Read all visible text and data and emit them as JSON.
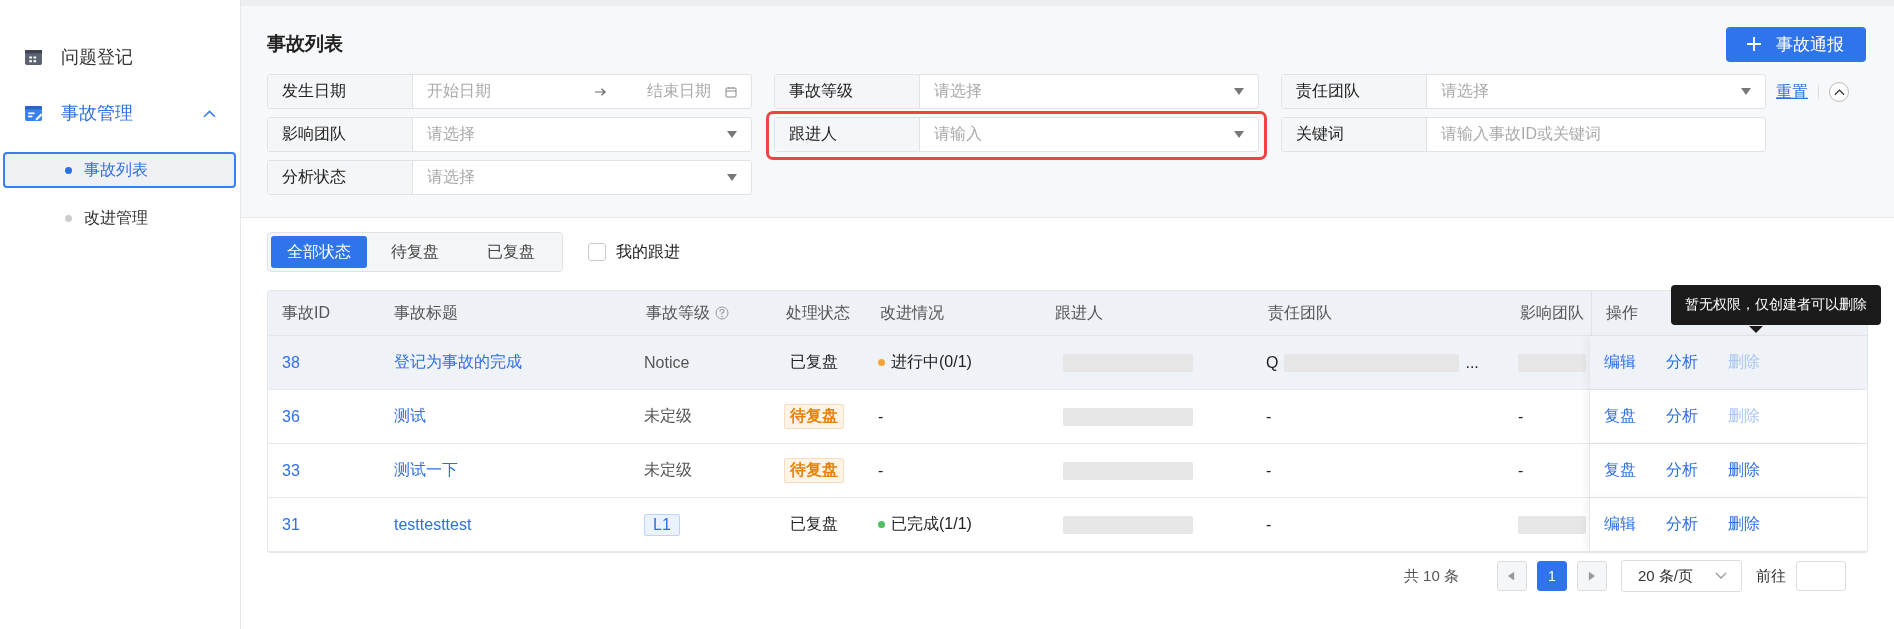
{
  "sidebar": {
    "items": [
      {
        "label": "问题登记",
        "selected": false
      },
      {
        "label": "事故管理",
        "selected": true,
        "expanded": true,
        "children": [
          {
            "label": "事故列表",
            "selected": true
          },
          {
            "label": "改进管理",
            "selected": false
          }
        ]
      }
    ]
  },
  "page_title": "事故列表",
  "report_button": {
    "label": "事故通报"
  },
  "filters": [
    {
      "label": "发生日期",
      "kind": "daterange",
      "start_placeholder": "开始日期",
      "end_placeholder": "结束日期",
      "highlighted": false
    },
    {
      "label": "事故等级",
      "kind": "select",
      "placeholder": "请选择",
      "highlighted": false
    },
    {
      "label": "责任团队",
      "kind": "select",
      "placeholder": "请选择",
      "highlighted": false
    },
    {
      "label": "影响团队",
      "kind": "select",
      "placeholder": "请选择",
      "highlighted": false
    },
    {
      "label": "跟进人",
      "kind": "select",
      "placeholder": "请输入",
      "highlighted": true
    },
    {
      "label": "关键词",
      "kind": "input",
      "placeholder": "请输入事故ID或关键词",
      "highlighted": false
    },
    {
      "label": "分析状态",
      "kind": "select",
      "placeholder": "请选择",
      "highlighted": false
    }
  ],
  "reset_link": "重置",
  "status_tabs": [
    {
      "label": "全部状态",
      "selected": true
    },
    {
      "label": "待复盘",
      "selected": false
    },
    {
      "label": "已复盘",
      "selected": false
    }
  ],
  "my_follow": {
    "label": "我的跟进",
    "checked": false
  },
  "table": {
    "columns": [
      {
        "label": "事故ID"
      },
      {
        "label": "事故标题"
      },
      {
        "label": "事故等级",
        "help": true
      },
      {
        "label": "处理状态"
      },
      {
        "label": "改进情况"
      },
      {
        "label": "跟进人"
      },
      {
        "label": "责任团队"
      },
      {
        "label": "影响团队"
      },
      {
        "label": "操作"
      }
    ],
    "rows": [
      {
        "id": "38",
        "title": "登记为事故的完成",
        "level": {
          "text": "Notice",
          "kind": "text"
        },
        "status": {
          "text": "已复盘",
          "kind": "plain"
        },
        "improvement": {
          "text": "进行中(0/1)",
          "color": "#f7a234"
        },
        "follower": {
          "kind": "redacted"
        },
        "team": {
          "text": "Q",
          "tail": "...",
          "kind": "redacted"
        },
        "impact": {
          "kind": "redacted"
        },
        "hover": true,
        "actions": [
          {
            "label": "编辑",
            "disabled": false
          },
          {
            "label": "分析",
            "disabled": false
          },
          {
            "label": "删除",
            "disabled": true
          }
        ]
      },
      {
        "id": "36",
        "title": "测试",
        "level": {
          "text": "未定级",
          "kind": "text"
        },
        "status": {
          "text": "待复盘",
          "kind": "tag"
        },
        "improvement": {
          "text": "-"
        },
        "follower": {
          "kind": "redacted"
        },
        "team": {
          "text": "-",
          "kind": "text"
        },
        "impact": {
          "text": "-",
          "kind": "text"
        },
        "hover": false,
        "actions": [
          {
            "label": "复盘",
            "disabled": false
          },
          {
            "label": "分析",
            "disabled": false
          },
          {
            "label": "删除",
            "disabled": true
          }
        ]
      },
      {
        "id": "33",
        "title": "测试一下",
        "level": {
          "text": "未定级",
          "kind": "text"
        },
        "status": {
          "text": "待复盘",
          "kind": "tag"
        },
        "improvement": {
          "text": "-"
        },
        "follower": {
          "kind": "redacted"
        },
        "team": {
          "text": "-",
          "kind": "text"
        },
        "impact": {
          "text": "-",
          "kind": "text"
        },
        "hover": false,
        "actions": [
          {
            "label": "复盘",
            "disabled": false
          },
          {
            "label": "分析",
            "disabled": false
          },
          {
            "label": "删除",
            "disabled": false
          }
        ]
      },
      {
        "id": "31",
        "title": "testtesttest",
        "level": {
          "text": "L1",
          "kind": "tag"
        },
        "status": {
          "text": "已复盘",
          "kind": "plain"
        },
        "improvement": {
          "text": "已完成(1/1)",
          "color": "#4cc164"
        },
        "follower": {
          "kind": "redacted"
        },
        "team": {
          "text": "-",
          "kind": "text"
        },
        "impact": {
          "kind": "redacted"
        },
        "hover": false,
        "actions": [
          {
            "label": "编辑",
            "disabled": false
          },
          {
            "label": "分析",
            "disabled": false
          },
          {
            "label": "删除",
            "disabled": false
          }
        ]
      }
    ]
  },
  "tooltip": "暂无权限，仅创建者可以删除",
  "pagination": {
    "total": "共 10 条",
    "pages": [
      {
        "label": "1",
        "selected": true
      }
    ],
    "page_size": "20 条/页",
    "goto": "前往"
  }
}
